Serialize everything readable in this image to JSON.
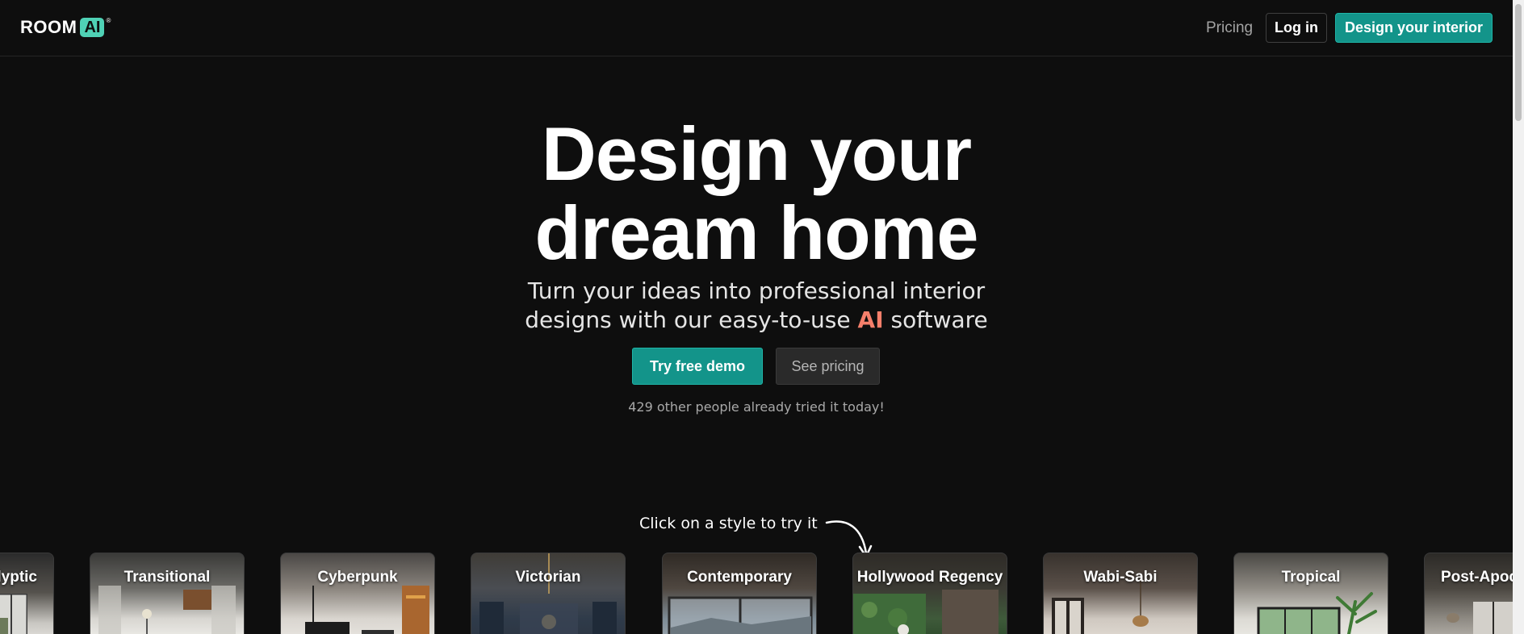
{
  "header": {
    "logo_word": "ROOM",
    "logo_badge": "AI",
    "logo_reg": "®",
    "pricing_link": "Pricing",
    "login_button": "Log in",
    "design_button": "Design your interior"
  },
  "hero": {
    "title_line1": "Design your",
    "title_line2": "dream home",
    "subtitle_line1": "Turn your ideas into professional interior",
    "subtitle_line2_pre": "designs with our easy-to-use ",
    "subtitle_ai": "AI",
    "subtitle_line2_post": " software",
    "demo_button": "Try free demo",
    "pricing_button": "See pricing",
    "social_proof": "429 other people already tried it today!"
  },
  "styles": {
    "hint": "Click on a style to try it",
    "cards": [
      {
        "label": "lyptic"
      },
      {
        "label": "Transitional"
      },
      {
        "label": "Cyberpunk"
      },
      {
        "label": "Victorian"
      },
      {
        "label": "Contemporary"
      },
      {
        "label": "Hollywood Regency"
      },
      {
        "label": "Wabi-Sabi"
      },
      {
        "label": "Tropical"
      },
      {
        "label": "Post-Apoc"
      }
    ]
  },
  "colors": {
    "background": "#0e0e0e",
    "brand_teal": "#13948a",
    "logo_mint": "#4fd1b5",
    "ai_accent": "#f57f6b"
  }
}
